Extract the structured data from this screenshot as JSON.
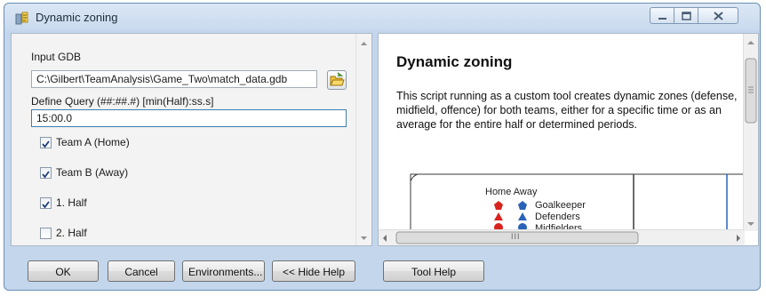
{
  "window": {
    "title": "Dynamic zoning"
  },
  "form": {
    "input_gdb": {
      "label": "Input GDB",
      "value": "C:\\Gilbert\\TeamAnalysis\\Game_Two\\match_data.gdb"
    },
    "query": {
      "label": "Define Query (##:##.#) [min(Half):ss.s]",
      "value": "15:00.0"
    },
    "checkboxes": [
      {
        "label": "Team A (Home)",
        "checked": true
      },
      {
        "label": "Team B (Away)",
        "checked": true
      },
      {
        "label": "1. Half",
        "checked": true
      },
      {
        "label": "2. Half",
        "checked": false
      }
    ]
  },
  "help": {
    "title": "Dynamic zoning",
    "body": "This script running as a custom tool creates dynamic zones (defense, midfield, offence) for both teams, either for a specific time or as an average for the entire half or determined periods.",
    "figure": {
      "legend_header": "Home Away",
      "items": [
        "Goalkeeper",
        "Defenders",
        "Midfielders"
      ]
    },
    "scroll_grip": "III"
  },
  "buttons": {
    "ok": "OK",
    "cancel": "Cancel",
    "environments": "Environments...",
    "hide_help": "<< Hide Help",
    "tool_help": "Tool Help"
  },
  "colors": {
    "home": "#d9231f",
    "away": "#2a63b8"
  }
}
